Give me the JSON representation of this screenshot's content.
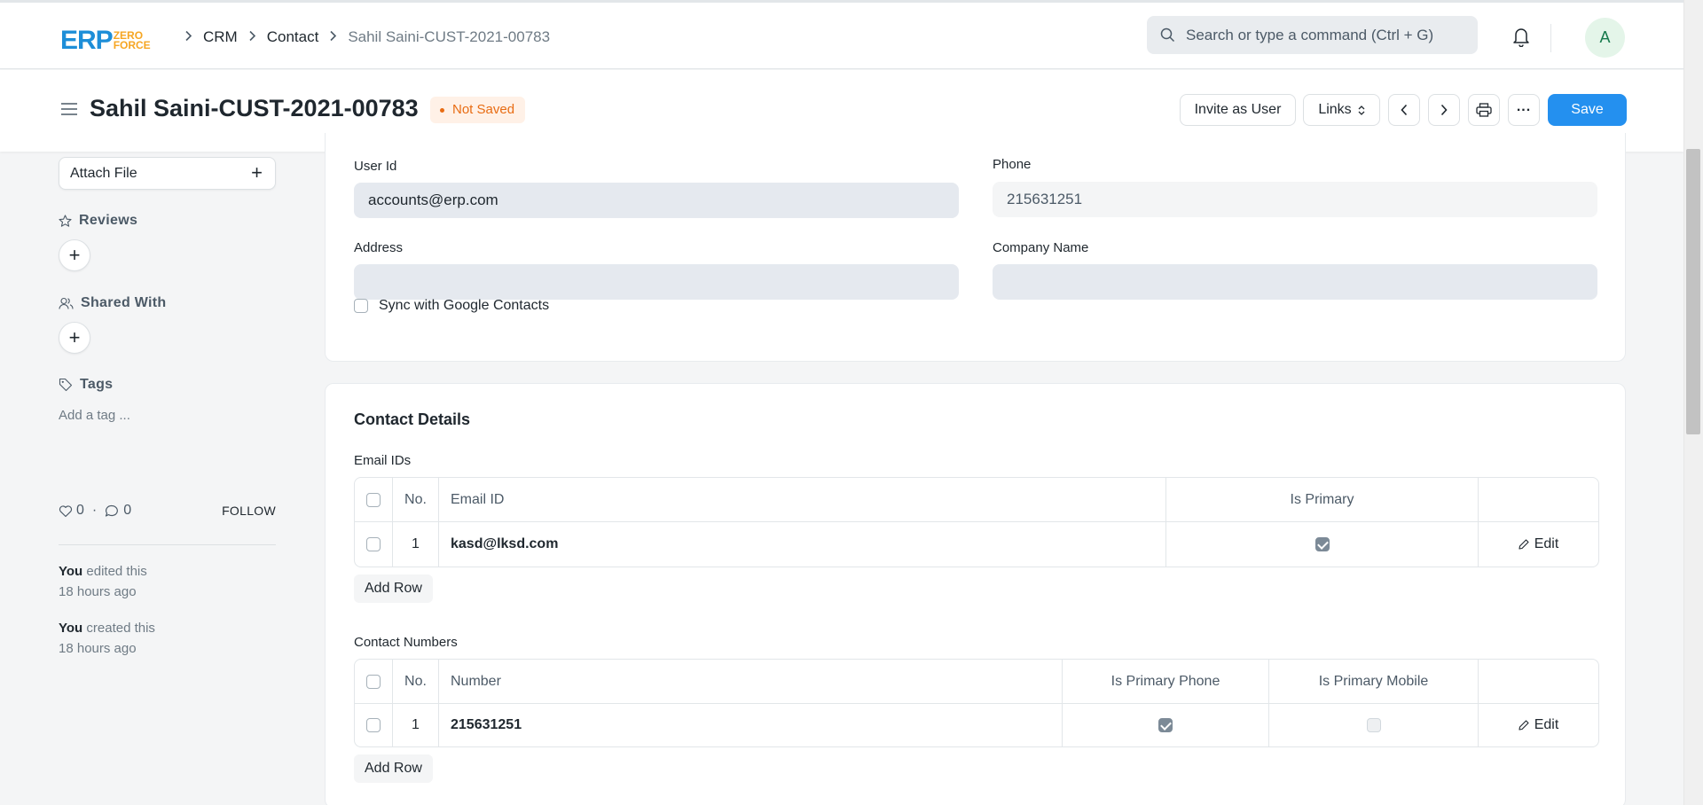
{
  "navbar": {
    "logo_main": "ERP",
    "logo_sub_1": "ZERO",
    "logo_sub_2": "FORCE",
    "breadcrumbs": [
      "CRM",
      "Contact",
      "Sahil Saini-CUST-2021-00783"
    ],
    "search_placeholder": "Search or type a command (Ctrl + G)",
    "avatar_initial": "A"
  },
  "page": {
    "title": "Sahil Saini-CUST-2021-00783",
    "status": "Not Saved",
    "buttons": {
      "invite": "Invite as User",
      "links": "Links",
      "more": "...",
      "save": "Save"
    }
  },
  "sidebar": {
    "attach_file": "Attach File",
    "reviews": "Reviews",
    "shared_with": "Shared With",
    "tags": "Tags",
    "add_tag": "Add a tag ...",
    "likes": "0",
    "comments": "0",
    "follow": "FOLLOW",
    "activity": [
      {
        "who": "You",
        "action": "edited this",
        "when": "18 hours ago"
      },
      {
        "who": "You",
        "action": "created this",
        "when": "18 hours ago"
      }
    ]
  },
  "form": {
    "user_id_label": "User Id",
    "user_id_value": "accounts@erp.com",
    "phone_label": "Phone",
    "phone_value": "215631251",
    "address_label": "Address",
    "address_value": "",
    "company_label": "Company Name",
    "company_value": "",
    "sync_label": "Sync with Google Contacts"
  },
  "contact_details": {
    "title": "Contact Details",
    "email_table": {
      "label": "Email IDs",
      "headers": [
        "No.",
        "Email ID",
        "Is Primary"
      ],
      "rows": [
        {
          "no": "1",
          "email": "kasd@lksd.com",
          "is_primary": true
        }
      ],
      "edit": "Edit",
      "add_row": "Add Row"
    },
    "phone_table": {
      "label": "Contact Numbers",
      "headers": [
        "No.",
        "Number",
        "Is Primary Phone",
        "Is Primary Mobile"
      ],
      "rows": [
        {
          "no": "1",
          "number": "215631251",
          "is_primary_phone": true,
          "is_primary_mobile": false
        }
      ],
      "edit": "Edit",
      "add_row": "Add Row"
    }
  },
  "colors": {
    "primary": "#2490ef",
    "status_orange": "#e86c13",
    "logo_blue": "#1d8ed8",
    "logo_orange": "#f6a623"
  }
}
